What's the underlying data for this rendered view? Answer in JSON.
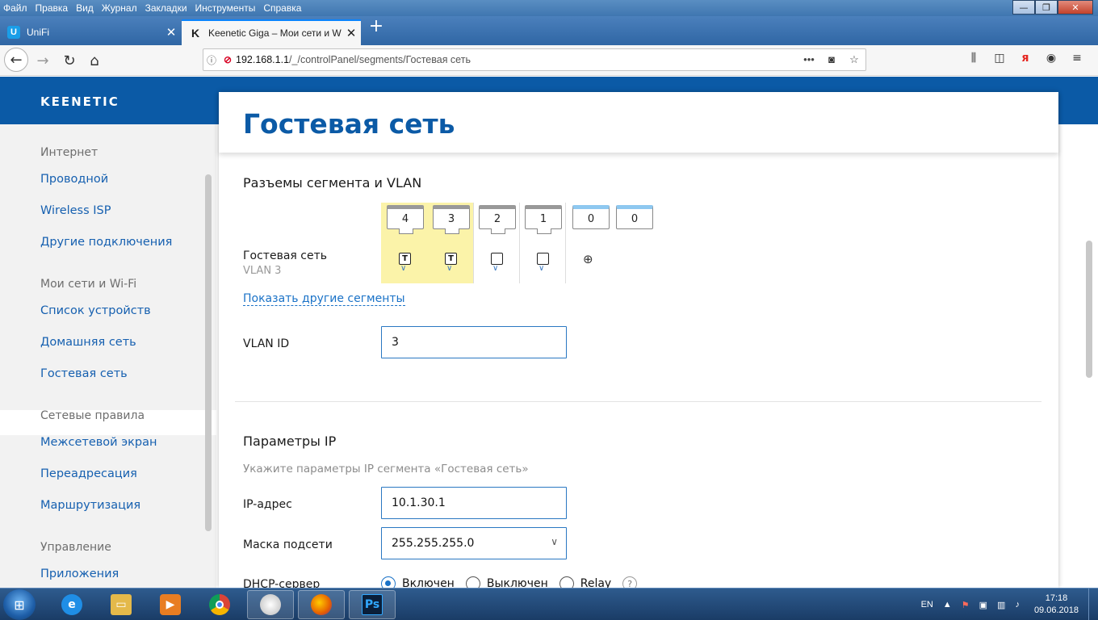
{
  "menu": [
    "Файл",
    "Правка",
    "Вид",
    "Журнал",
    "Закладки",
    "Инструменты",
    "Справка"
  ],
  "window_controls": {
    "minimize": "—",
    "maximize": "❐",
    "close": "✕"
  },
  "tabs": [
    {
      "label": "UniFi",
      "favicon": "U"
    },
    {
      "label": "Keenetic Giga – Мои сети и Wi-Fi",
      "favicon": "K"
    }
  ],
  "tab_close": "✕",
  "new_tab": "+",
  "url": {
    "host": "192.168.1.1",
    "path": "/_/controlPanel/segments/Гостевая сеть"
  },
  "brand": "KEENETIC",
  "sidebar": {
    "groups": [
      {
        "title": "Интернет",
        "items": [
          "Проводной",
          "Wireless ISP",
          "Другие подключения"
        ]
      },
      {
        "title": "Мои сети и Wi-Fi",
        "items": [
          "Список устройств",
          "Домашняя сеть",
          "Гостевая сеть"
        ]
      },
      {
        "title": "Сетевые правила",
        "items": [
          "Межсетевой экран",
          "Переадресация",
          "Маршрутизация"
        ]
      },
      {
        "title": "Управление",
        "items": [
          "Приложения"
        ]
      }
    ],
    "active": "Гостевая сеть"
  },
  "main": {
    "title": "Гостевая сеть",
    "ports_section": {
      "title": "Разъемы сегмента и VLAN",
      "ports": [
        "4",
        "3",
        "2",
        "1",
        "0",
        "0"
      ],
      "segment_name": "Гостевая сеть",
      "segment_vlan": "VLAN 3",
      "tagged_mark": "T",
      "show_other": "Показать другие сегменты",
      "vlan_id_label": "VLAN ID",
      "vlan_id_value": "3"
    },
    "ip_section": {
      "title": "Параметры IP",
      "hint": "Укажите параметры IP сегмента «Гостевая сеть»",
      "ip_label": "IP-адрес",
      "ip_value": "10.1.30.1",
      "mask_label": "Маска подсети",
      "mask_value": "255.255.255.0",
      "dhcp_label": "DHCP-сервер",
      "dhcp_options": [
        "Включен",
        "Выключен",
        "Relay"
      ],
      "dhcp_selected": "Включен",
      "help": "?"
    }
  },
  "taskbar": {
    "lang": "EN",
    "time": "17:18",
    "date": "09.06.2018"
  }
}
